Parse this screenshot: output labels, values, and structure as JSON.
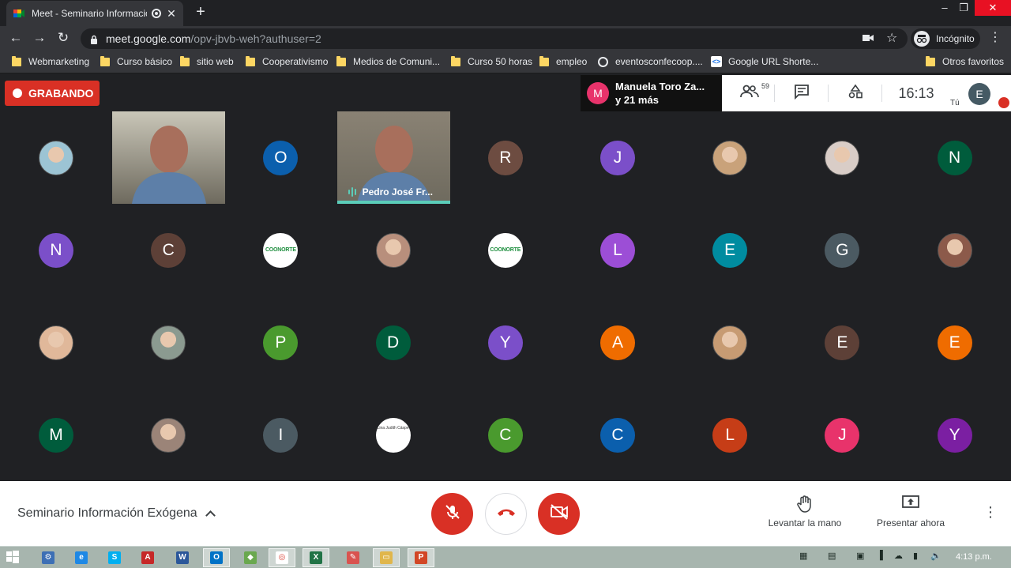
{
  "browser": {
    "tab_title": "Meet - Seminario Informació",
    "new_tab_symbol": "+",
    "url_host": "meet.google.com",
    "url_path": "/opv-jbvb-weh?authuser=2",
    "incognito_label": "Incógnito",
    "bookmarks": [
      {
        "label": "Webmarketing",
        "icon": "folder-icon"
      },
      {
        "label": "Curso básico",
        "icon": "folder-icon"
      },
      {
        "label": "sitio web",
        "icon": "folder-icon"
      },
      {
        "label": "Cooperativismo",
        "icon": "folder-icon"
      },
      {
        "label": "Medios de Comuni...",
        "icon": "folder-icon"
      },
      {
        "label": "Curso 50 horas",
        "icon": "folder-icon"
      },
      {
        "label": "empleo",
        "icon": "folder-icon"
      },
      {
        "label": "eventosconfecoop....",
        "icon": "globe-icon"
      },
      {
        "label": "Google URL Shorte...",
        "icon": "google-url-shortener-icon"
      }
    ],
    "other_bookmarks": "Otros favoritos"
  },
  "meet": {
    "recording_label": "GRABANDO",
    "speaker_avatar": "M",
    "speaker_name": "Manuela Toro Za...",
    "speaker_more": "y 21 más",
    "people_count": "59",
    "clock": "16:13",
    "self_avatar": "E",
    "self_label": "Tú",
    "meeting_title": "Seminario Información Exógena",
    "raise_hand_label": "Levantar la mano",
    "present_label": "Presentar ahora",
    "video_tile_name": "Pedro José Fr...",
    "logo_text": "COONORTE",
    "doc_text": "Lina Judith Cáspe"
  },
  "participants": [
    {
      "type": "photo",
      "initial": "",
      "color": "#9cc4d4"
    },
    {
      "type": "video",
      "initial": "",
      "color": "#c9c6b8"
    },
    {
      "type": "letter",
      "initial": "O",
      "color": "#0b5fad"
    },
    {
      "type": "video-speaking",
      "initial": "",
      "color": "#8a8274"
    },
    {
      "type": "letter",
      "initial": "R",
      "color": "#6d4c41"
    },
    {
      "type": "letter",
      "initial": "J",
      "color": "#7b4fc9"
    },
    {
      "type": "photo",
      "initial": "",
      "color": "#c9a27a"
    },
    {
      "type": "photo",
      "initial": "",
      "color": "#d9cdc7"
    },
    {
      "type": "letter",
      "initial": "N",
      "color": "#005c3c"
    },
    {
      "type": "letter",
      "initial": "N",
      "color": "#7b4fc9"
    },
    {
      "type": "letter",
      "initial": "C",
      "color": "#5d4037"
    },
    {
      "type": "logo",
      "initial": "",
      "color": "#ffffff"
    },
    {
      "type": "photo",
      "initial": "",
      "color": "#b88f7c"
    },
    {
      "type": "logo",
      "initial": "",
      "color": "#ffffff"
    },
    {
      "type": "letter",
      "initial": "L",
      "color": "#9c4ed6"
    },
    {
      "type": "letter",
      "initial": "E",
      "color": "#008ca0"
    },
    {
      "type": "letter",
      "initial": "G",
      "color": "#4b5a62"
    },
    {
      "type": "photo",
      "initial": "",
      "color": "#8c5a4a"
    },
    {
      "type": "photo",
      "initial": "",
      "color": "#e0b89a"
    },
    {
      "type": "photo",
      "initial": "",
      "color": "#8b9a90"
    },
    {
      "type": "letter",
      "initial": "P",
      "color": "#4a9a2e"
    },
    {
      "type": "letter",
      "initial": "D",
      "color": "#005c3c"
    },
    {
      "type": "letter",
      "initial": "Y",
      "color": "#7b4fc9"
    },
    {
      "type": "letter",
      "initial": "A",
      "color": "#ef6c00"
    },
    {
      "type": "photo",
      "initial": "",
      "color": "#c79b73"
    },
    {
      "type": "letter",
      "initial": "E",
      "color": "#5d4037"
    },
    {
      "type": "letter",
      "initial": "E",
      "color": "#ef6c00"
    },
    {
      "type": "letter",
      "initial": "M",
      "color": "#005c3c"
    },
    {
      "type": "photo",
      "initial": "",
      "color": "#9b8478"
    },
    {
      "type": "letter",
      "initial": "I",
      "color": "#4b5a62"
    },
    {
      "type": "doc",
      "initial": "",
      "color": "#ffffff"
    },
    {
      "type": "letter",
      "initial": "C",
      "color": "#4a9a2e"
    },
    {
      "type": "letter",
      "initial": "C",
      "color": "#0b5fad"
    },
    {
      "type": "letter",
      "initial": "L",
      "color": "#c63d17"
    },
    {
      "type": "letter",
      "initial": "J",
      "color": "#e8336b"
    },
    {
      "type": "letter",
      "initial": "Y",
      "color": "#7b1fa2"
    }
  ],
  "taskbar": {
    "clock": "4:13 p.m.",
    "apps": [
      {
        "icon": "windows-logo-icon"
      },
      {
        "icon": "system-app-icon"
      },
      {
        "icon": "edge-icon"
      },
      {
        "icon": "skype-icon"
      },
      {
        "icon": "acrobat-icon"
      },
      {
        "icon": "word-icon"
      },
      {
        "icon": "outlook-icon"
      },
      {
        "icon": "app-icon"
      },
      {
        "icon": "chrome-icon"
      },
      {
        "icon": "excel-icon"
      },
      {
        "icon": "paint-icon"
      },
      {
        "icon": "explorer-icon"
      },
      {
        "icon": "powerpoint-icon"
      }
    ]
  }
}
